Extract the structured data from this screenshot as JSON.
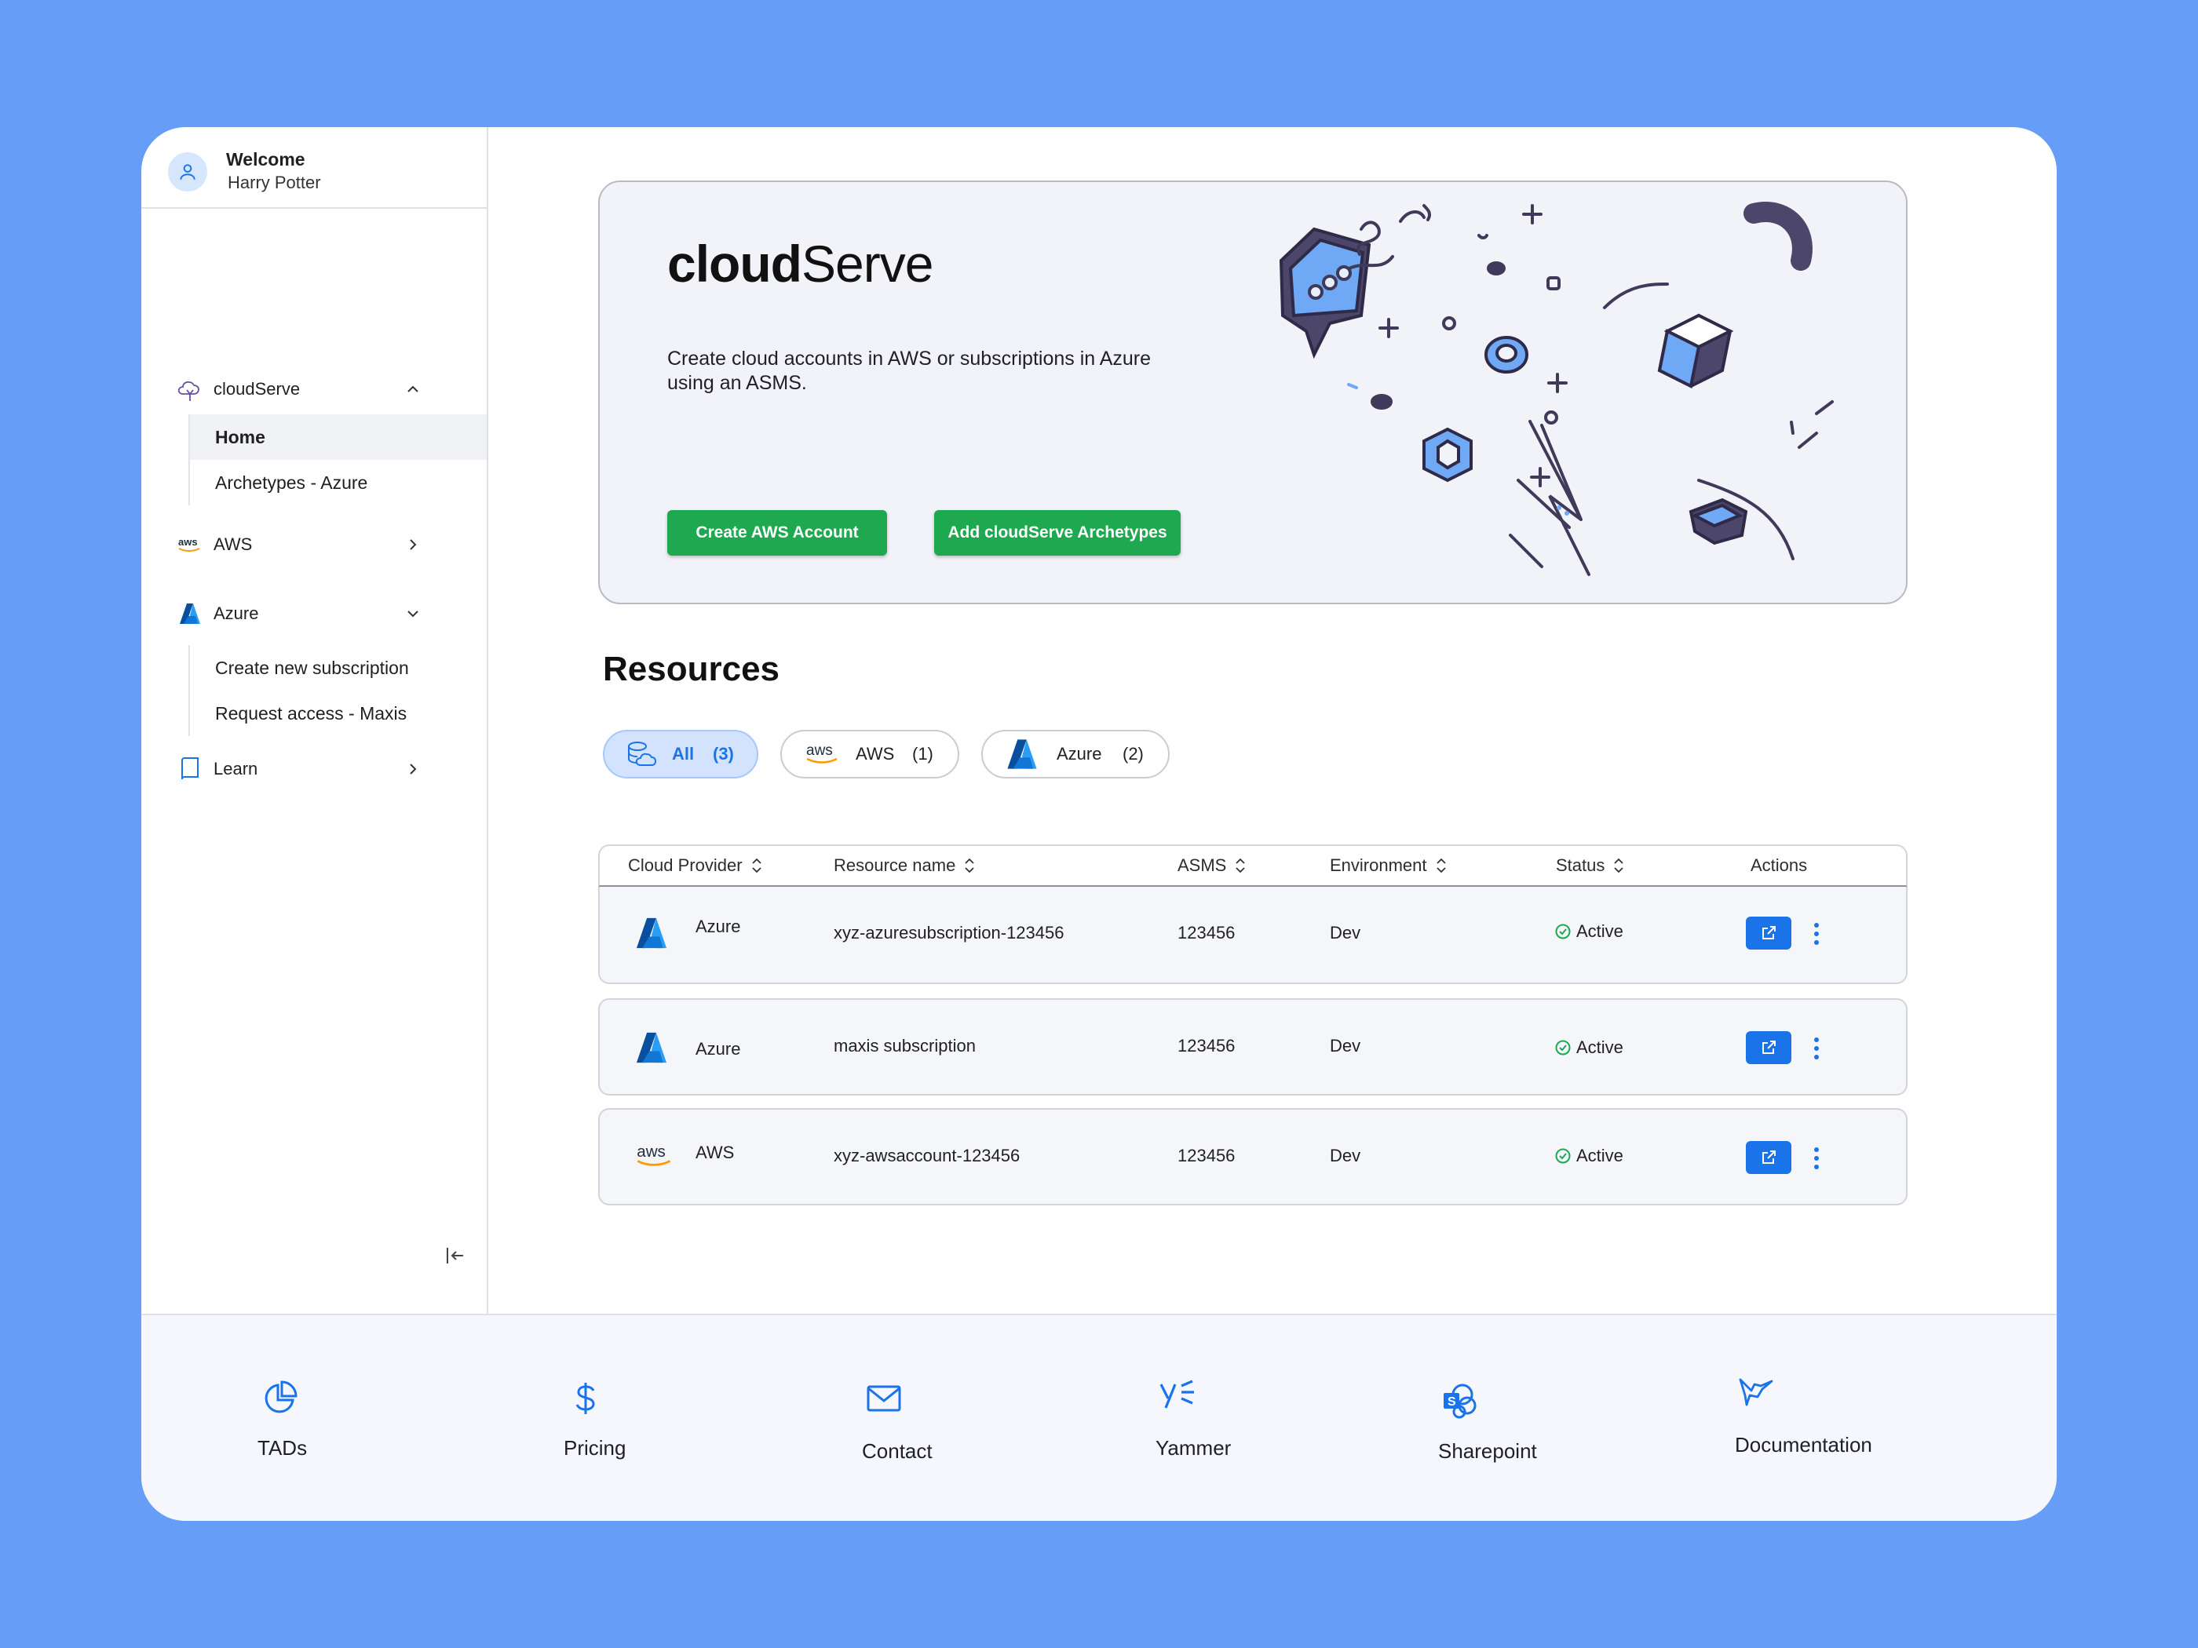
{
  "user": {
    "greeting": "Welcome",
    "name": "Harry Potter"
  },
  "sidebar": {
    "items": [
      {
        "label": "cloudServe",
        "icon": "cloud-tree-icon",
        "expanded": true,
        "children": [
          {
            "label": "Home",
            "active": true
          },
          {
            "label": "Archetypes - Azure"
          }
        ]
      },
      {
        "label": "AWS",
        "icon": "aws-logo-icon",
        "expanded": false
      },
      {
        "label": "Azure",
        "icon": "azure-logo-icon",
        "expanded": true,
        "children": [
          {
            "label": "Create new subscription"
          },
          {
            "label": "Request access - Maxis"
          }
        ]
      },
      {
        "label": "Learn",
        "icon": "book-icon",
        "expanded": false
      }
    ],
    "collapse_icon": "collapse-sidebar-icon"
  },
  "hero": {
    "title_bold": "cloud",
    "title_light": "Serve",
    "description": "Create cloud accounts in AWS or subscriptions in Azure using an ASMS.",
    "buttons": {
      "create_aws": "Create AWS Account",
      "add_archetypes": "Add cloudServe Archetypes"
    }
  },
  "resources": {
    "title": "Resources",
    "filters": [
      {
        "label": "All",
        "count": "(3)",
        "active": true,
        "icon": "cloud-database-icon"
      },
      {
        "label": "AWS",
        "count": "(1)",
        "icon": "aws-logo-icon"
      },
      {
        "label": "Azure",
        "count": "(2)",
        "icon": "azure-logo-icon"
      }
    ],
    "columns": [
      "Cloud Provider",
      "Resource name",
      "ASMS",
      "Environment",
      "Status",
      "Actions"
    ],
    "rows": [
      {
        "provider": "Azure",
        "resource": "xyz-azuresubscription-123456",
        "asms": "123456",
        "environment": "Dev",
        "status": "Active"
      },
      {
        "provider": "Azure",
        "resource": "maxis subscription",
        "asms": "123456",
        "environment": "Dev",
        "status": "Active"
      },
      {
        "provider": "AWS",
        "resource": "xyz-awsaccount-123456",
        "asms": "123456",
        "environment": "Dev",
        "status": "Active"
      }
    ]
  },
  "footer": {
    "links": [
      {
        "label": "TADs",
        "icon": "pie-chart-icon"
      },
      {
        "label": "Pricing",
        "icon": "dollar-icon"
      },
      {
        "label": "Contact",
        "icon": "mail-icon"
      },
      {
        "label": "Yammer",
        "icon": "yammer-icon"
      },
      {
        "label": "Sharepoint",
        "icon": "sharepoint-icon"
      },
      {
        "label": "Documentation",
        "icon": "hummingbird-icon"
      }
    ]
  },
  "colors": {
    "background": "#669df6",
    "primary": "#1a73e8",
    "success": "#1ea84f",
    "azure": "#0078d4",
    "aws_orange": "#ff9900"
  }
}
